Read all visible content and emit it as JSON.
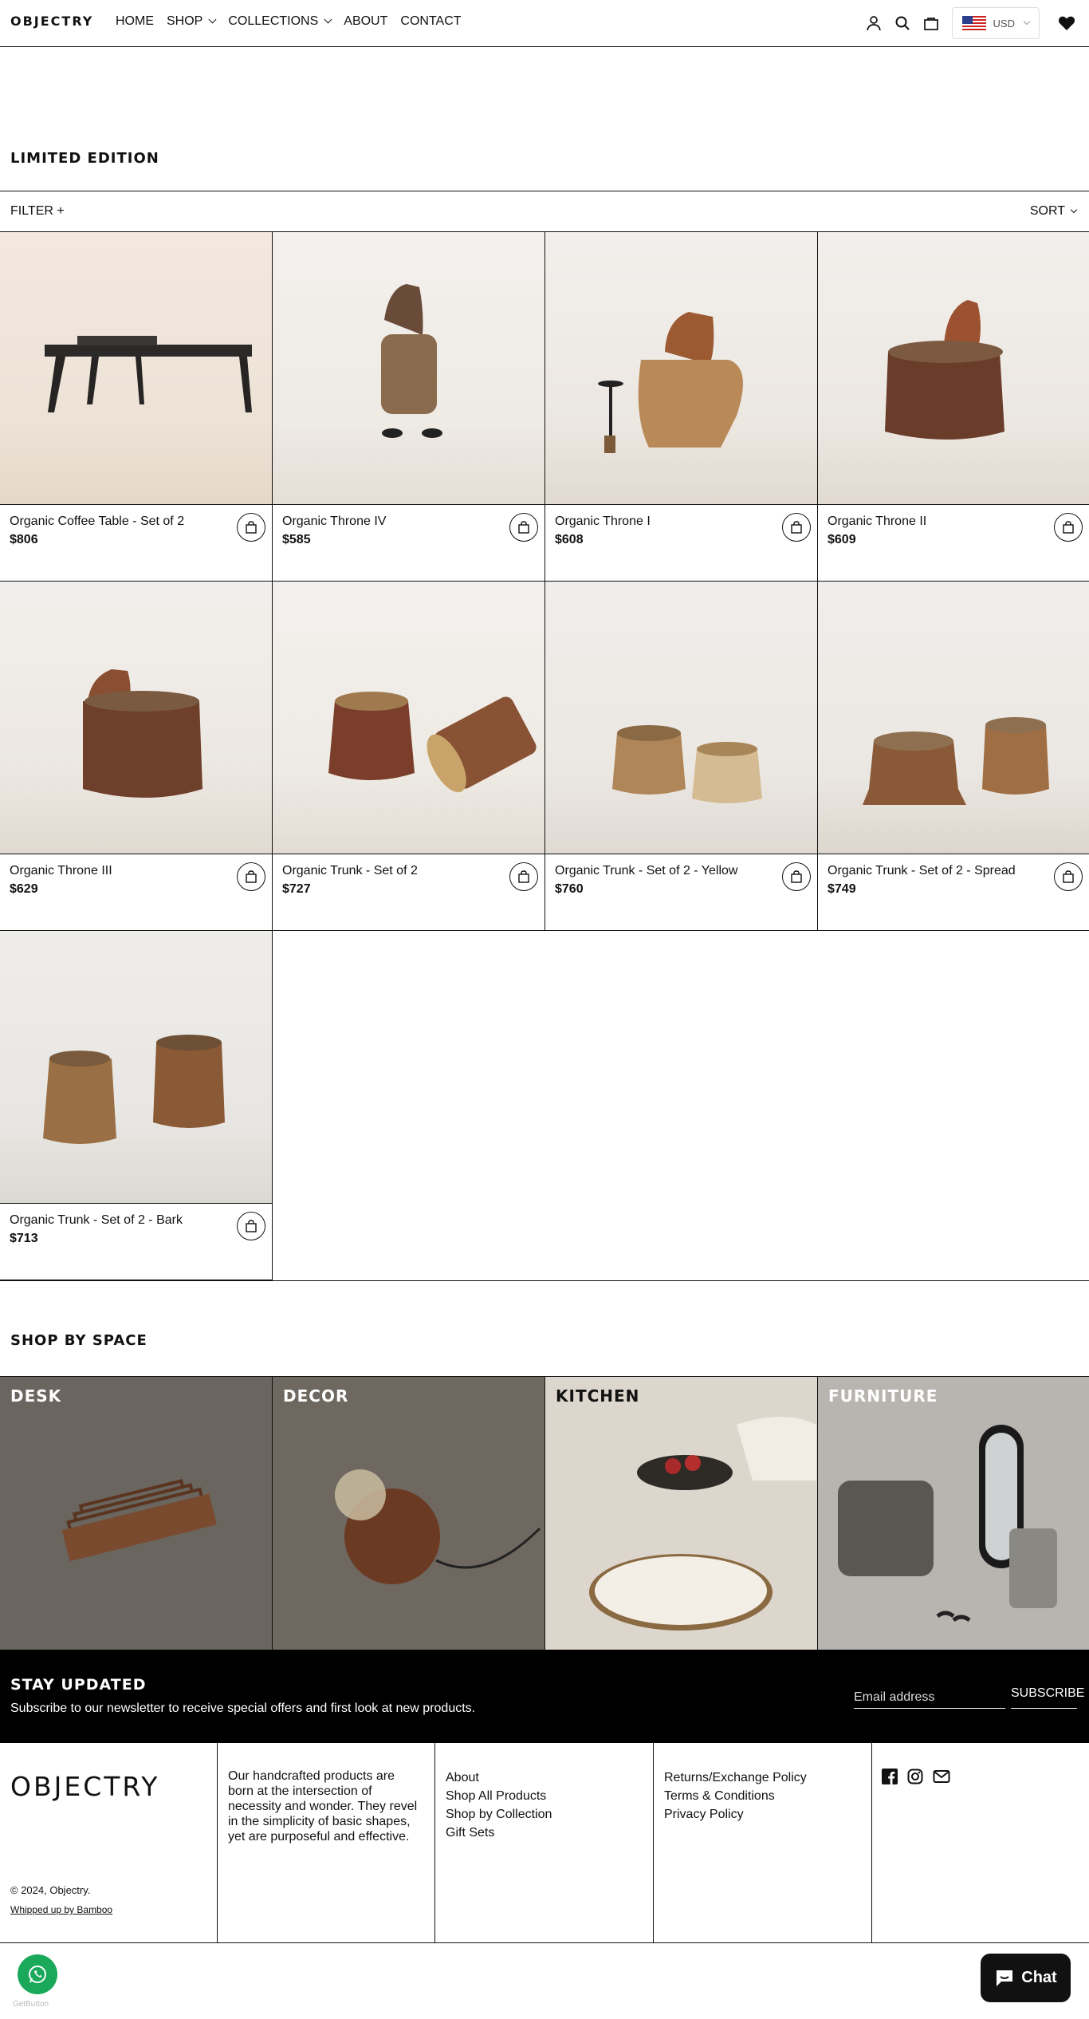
{
  "header": {
    "logo": "OBJECTRY",
    "nav": [
      "HOME",
      "SHOP",
      "COLLECTIONS",
      "ABOUT",
      "CONTACT"
    ],
    "currency": "USD"
  },
  "collection": {
    "title": "LIMITED EDITION",
    "filter_label": "FILTER +",
    "sort_label": "SORT",
    "products": [
      {
        "name": "Organic Coffee Table - Set of 2",
        "price": "$806"
      },
      {
        "name": "Organic Throne IV",
        "price": "$585"
      },
      {
        "name": "Organic Throne I",
        "price": "$608"
      },
      {
        "name": "Organic Throne II",
        "price": "$609"
      },
      {
        "name": "Organic Throne III",
        "price": "$629"
      },
      {
        "name": "Organic Trunk - Set of 2",
        "price": "$727"
      },
      {
        "name": "Organic Trunk - Set of 2 - Yellow",
        "price": "$760"
      },
      {
        "name": "Organic Trunk - Set of 2 - Spread",
        "price": "$749"
      },
      {
        "name": "Organic Trunk - Set of 2 - Bark",
        "price": "$713"
      }
    ]
  },
  "shop_by_space": {
    "title": "SHOP BY SPACE",
    "tiles": [
      "DESK",
      "DECOR",
      "KITCHEN",
      "FURNITURE"
    ]
  },
  "newsletter": {
    "title": "STAY UPDATED",
    "text": "Subscribe to our newsletter to receive special offers and first look at new products.",
    "email_placeholder": "Email address",
    "button": "SUBSCRIBE"
  },
  "footer": {
    "logo": "OBJECTRY",
    "copyright": "© 2024, Objectry.",
    "credit": "Whipped up by Bamboo",
    "about_text": "Our handcrafted products are born at the intersection of necessity and wonder. They revel in the simplicity of basic shapes, yet are purposeful and effective.",
    "links_1": [
      "About",
      "Shop All Products",
      "Shop by Collection",
      "Gift Sets"
    ],
    "links_2": [
      "Returns/Exchange Policy",
      "Terms & Conditions",
      "Privacy Policy"
    ]
  },
  "widgets": {
    "chat_label": "Chat",
    "getbutton_label": "GetButton"
  }
}
